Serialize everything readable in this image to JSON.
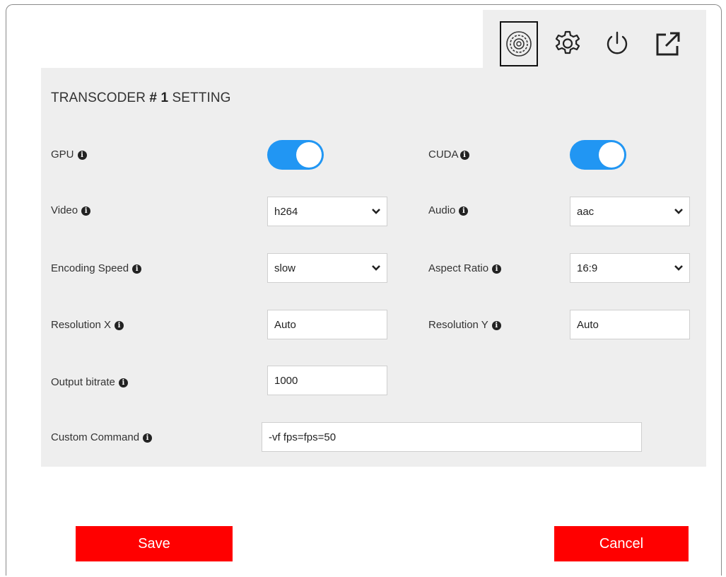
{
  "toolbar": {
    "icons": [
      "transcoder-settings-icon",
      "gear-icon",
      "power-icon",
      "external-link-icon"
    ]
  },
  "panel": {
    "title_prefix": "TRANSCODER",
    "title_number": "# 1",
    "title_suffix": "SETTING"
  },
  "fields": {
    "gpu": {
      "label": "GPU",
      "on": true
    },
    "cuda": {
      "label": "CUDA",
      "on": true
    },
    "video": {
      "label": "Video",
      "value": "h264"
    },
    "audio": {
      "label": "Audio",
      "value": "aac"
    },
    "encoding_speed": {
      "label": "Encoding Speed",
      "value": "slow"
    },
    "aspect_ratio": {
      "label": "Aspect Ratio",
      "value": "16:9"
    },
    "resolution_x": {
      "label": "Resolution X",
      "value": "Auto"
    },
    "resolution_y": {
      "label": "Resolution Y",
      "value": "Auto"
    },
    "output_bitrate": {
      "label": "Output bitrate",
      "value": "1000"
    },
    "custom_command": {
      "label": "Custom Command",
      "value": "-vf fps=fps=50"
    }
  },
  "info_glyph": "i",
  "actions": {
    "save_label": "Save",
    "cancel_label": "Cancel"
  },
  "colors": {
    "accent": "#2196f3",
    "danger": "#ff0000",
    "panel_bg": "#eeeeee"
  }
}
